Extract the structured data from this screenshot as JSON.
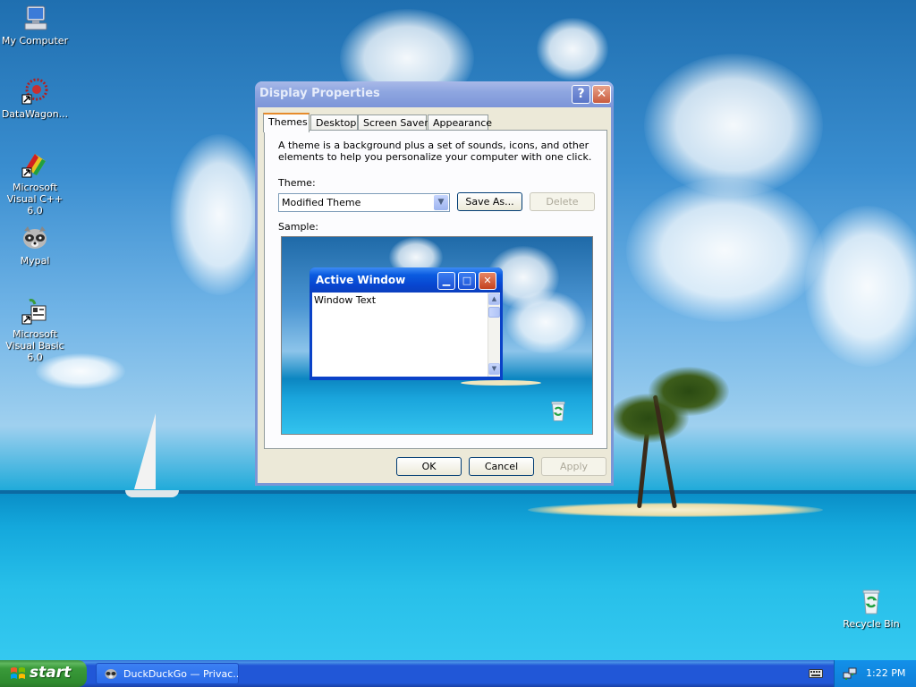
{
  "desktop": {
    "icons": [
      {
        "label": "My Computer",
        "icon": "my-computer-icon"
      },
      {
        "label": "DataWagon...",
        "icon": "datawagon-icon"
      },
      {
        "label": "Microsoft Visual C++ 6.0",
        "icon": "visual-cpp-icon"
      },
      {
        "label": "Mypal",
        "icon": "mypal-raccoon-icon"
      },
      {
        "label": "Microsoft Visual Basic 6.0",
        "icon": "visual-basic-icon"
      },
      {
        "label": "Recycle Bin",
        "icon": "recycle-bin-icon"
      }
    ]
  },
  "dialog": {
    "title": "Display Properties",
    "help_label": "?",
    "close_label": "✕",
    "tabs": [
      {
        "label": "Themes",
        "active": true
      },
      {
        "label": "Desktop"
      },
      {
        "label": "Screen Saver"
      },
      {
        "label": "Appearance"
      }
    ],
    "description": "A theme is a background plus a set of sounds, icons, and other elements to help you personalize your computer with one click.",
    "theme_label": "Theme:",
    "theme_value": "Modified Theme",
    "save_as_label": "Save As...",
    "delete_label": "Delete",
    "sample_label": "Sample:",
    "sample": {
      "window_title": "Active Window",
      "window_text": "Window Text"
    },
    "ok_label": "OK",
    "cancel_label": "Cancel",
    "apply_label": "Apply"
  },
  "taskbar": {
    "start_label": "start",
    "task_button_label": "DuckDuckGo — Privac...",
    "clock": "1:22 PM"
  },
  "colors": {
    "xp_blue_title": "#0a5be0",
    "taskbar_blue": "#2157d7",
    "start_green": "#3a9a3a",
    "dialog_face": "#ece9d8"
  }
}
